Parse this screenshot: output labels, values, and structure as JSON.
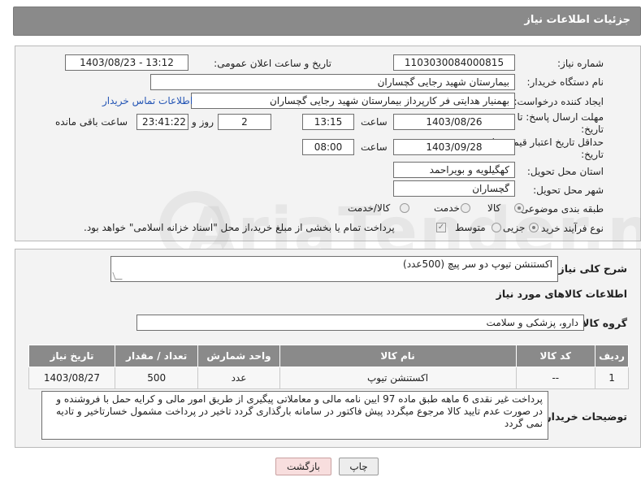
{
  "page": {
    "title": "جزئیات اطلاعات نیاز",
    "watermark": "AriaTender.net"
  },
  "form": {
    "need_number_label": "شماره نیاز:",
    "need_number": "1103030084000815",
    "announce_label": "تاریخ و ساعت اعلان عمومی:",
    "announce_value": "1403/08/23 - 13:12",
    "buyer_label": "نام دستگاه خریدار:",
    "buyer_value": "بیمارستان شهید رجایی گچساران",
    "creator_label": "ایجاد کننده درخواست:",
    "creator_value": "بهمنیار هدایتی فر کارپرداز بیمارستان شهید رجایی گچساران",
    "contact_link": "اطلاعات تماس خریدار",
    "deadline_label_line1": "مهلت ارسال پاسخ: تا",
    "deadline_label_line2": "تاریخ:",
    "deadline_date": "1403/08/26",
    "time_label": "ساعت",
    "deadline_time": "13:15",
    "days_value": "2",
    "days_label": "روز و",
    "remaining_time": "23:41:22",
    "remaining_label": "ساعت باقی مانده",
    "validity_label_line1": "حداقل تاریخ اعتبار قیمت: تا",
    "validity_label_line2": "تاریخ:",
    "validity_date": "1403/09/28",
    "validity_time": "08:00",
    "province_label": "استان محل تحویل:",
    "province_value": "کهگیلویه و بویراحمد",
    "city_label": "شهر محل تحویل:",
    "city_value": "گچساران",
    "category_label": "طبقه بندی موضوعی:",
    "category_options": [
      "کالا",
      "خدمت",
      "کالا/خدمت"
    ],
    "purchase_type_label": "نوع فرآیند خرید :",
    "purchase_options": [
      "جزیی",
      "متوسط"
    ],
    "treasury_note": "پرداخت تمام یا بخشی از مبلغ خرید،از محل \"اسناد خزانه اسلامی\" خواهد بود."
  },
  "details": {
    "description_label": "شرح کلی نیاز:",
    "description_value": "اکستنشن تیوپ دو سر پیچ  (500عدد)",
    "items_heading": "اطلاعات کالاهای مورد نیاز",
    "group_label": "گروه کالا:",
    "group_value": "دارو، پزشکی و سلامت",
    "table": {
      "headers": [
        "ردیف",
        "کد کالا",
        "نام کالا",
        "واحد شمارش",
        "تعداد / مقدار",
        "تاریخ نیاز"
      ],
      "rows": [
        [
          "1",
          "--",
          "اکستنشن تیوپ",
          "عدد",
          "500",
          "1403/08/27"
        ]
      ]
    },
    "buyer_notes_label": "توضیحات خریدار:",
    "buyer_notes": "پرداخت غیر نقدی 6 ماهه  طبق ماده 97 ایین نامه مالی و معاملاتی پیگیری از طریق امور مالی  و کرایه حمل با فروشنده و در صورت عدم تایید کالا مرجوع میگردد پیش فاکتور در سامانه بارگذاری گردد  تاخیر  در پرداخت مشمول خسارتاخیر و تادیه نمی گردد"
  },
  "buttons": {
    "print": "چاپ",
    "back": "بازگشت"
  }
}
